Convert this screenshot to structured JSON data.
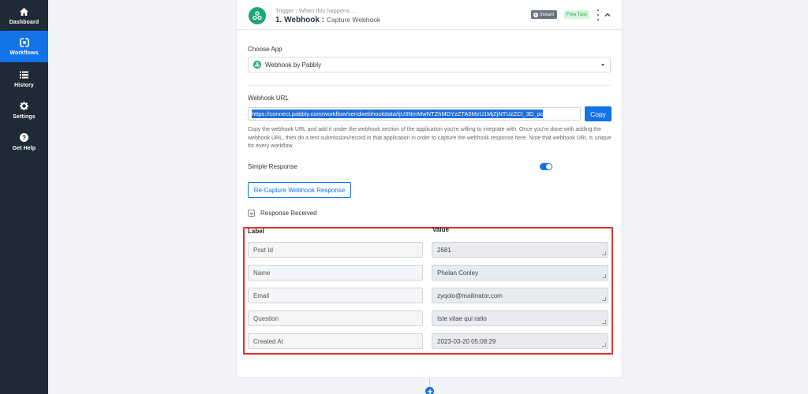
{
  "sidebar": {
    "items": [
      {
        "label": "Dashboard",
        "icon": "home-icon",
        "active": false
      },
      {
        "label": "Workflows",
        "icon": "workflow-icon",
        "active": true
      },
      {
        "label": "History",
        "icon": "list-icon",
        "active": false
      },
      {
        "label": "Settings",
        "icon": "gear-icon",
        "active": false
      },
      {
        "label": "Get Help",
        "icon": "question-icon",
        "active": false
      }
    ]
  },
  "trigger": {
    "subtitle": "Trigger : When this happens ...",
    "title": "1. Webhook :",
    "subtitle_action": "Capture Webhook",
    "badge_instant": "Instant",
    "badge_free": "Free Task"
  },
  "choose_app": {
    "label": "Choose App",
    "selected": "Webhook by Pabbly"
  },
  "webhook_url": {
    "label": "Webhook URL",
    "value": "https://connect.pabbly.com/workflow/sendwebhookdata/IjU3NmMwNTZhMDYzZTA0MzU1MjZjNTUzZCI_3D_pc",
    "copy_label": "Copy",
    "help": "Copy the webhook URL and add it under the webhook section of the application you're willing to integrate with. Once you're done with adding the webhook URL, then do a test submission/record in that application in order to capture the webhook response here. Note that webhook URL is unique for every workflow."
  },
  "simple_response": {
    "label": "Simple Response",
    "enabled": true
  },
  "recapture_label": "Re-Capture Webhook Response",
  "response": {
    "label": "Response Received",
    "col_label": "Label",
    "col_value": "Value",
    "rows": [
      {
        "label": "Post Id",
        "value": "2681"
      },
      {
        "label": "Name",
        "value": "Phelan Conley"
      },
      {
        "label": "Email",
        "value": "zyqolo@mailinator.com"
      },
      {
        "label": "Question",
        "value": "Iste vitae qui ratio"
      },
      {
        "label": "Created At",
        "value": "2023-03-20 05:08:29"
      }
    ]
  },
  "colors": {
    "accent": "#1473e6",
    "sidebar_bg": "#1f2a37",
    "app_green": "#1aa676",
    "highlight_red": "#e03131"
  }
}
